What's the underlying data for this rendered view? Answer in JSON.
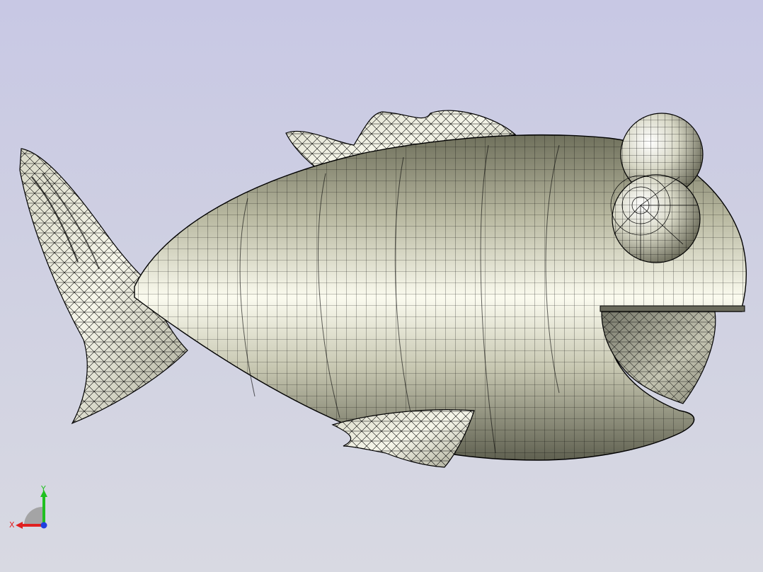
{
  "viewport": {
    "background_top": "#c8c8e4",
    "background_bottom": "#d8d9e2"
  },
  "model": {
    "shading": "shaded-with-edges",
    "surface_color": "#e6e6d6",
    "edge_color": "#000000",
    "parts": [
      "tail-fin-icon",
      "dorsal-fin-icon",
      "body-icon",
      "eye-icon",
      "mouth-icon",
      "pectoral-fin-icon"
    ]
  },
  "triad": {
    "x_label": "X",
    "y_label": "Y",
    "x_color": "#e02020",
    "y_color": "#20c020",
    "z_color": "#2040e0"
  }
}
